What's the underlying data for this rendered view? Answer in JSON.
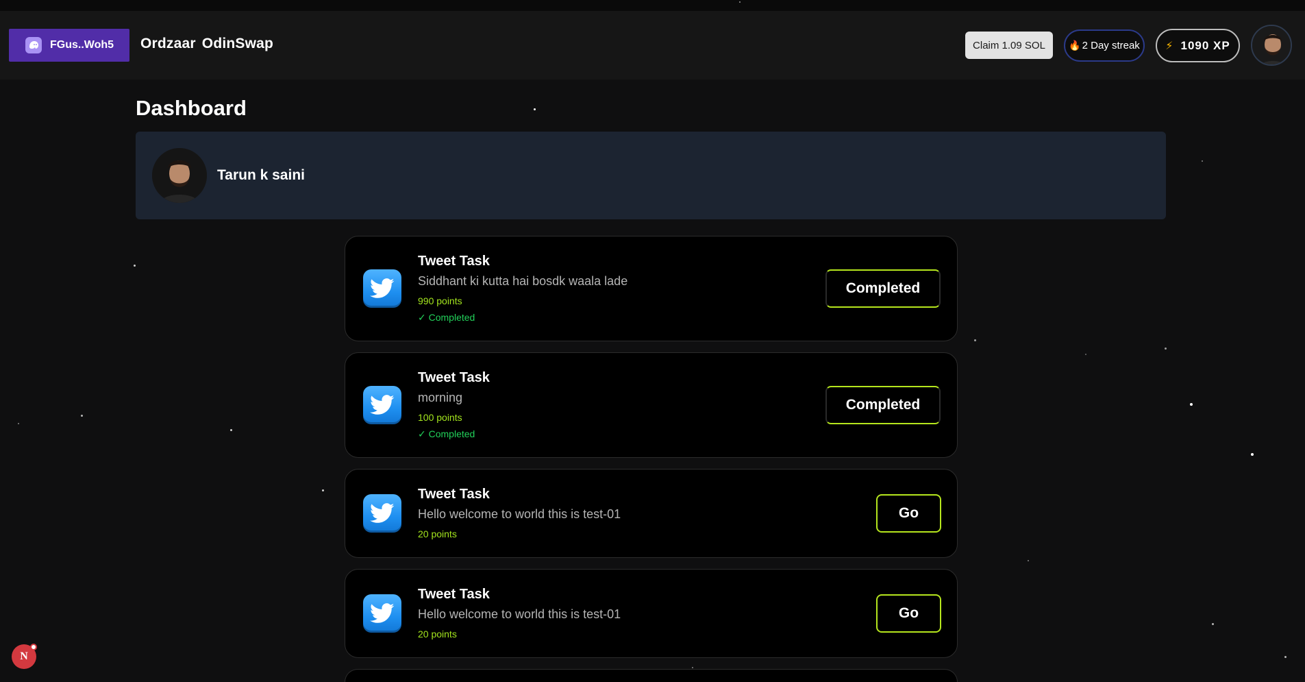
{
  "header": {
    "wallet_label": "FGus..Woh5",
    "brand": "Ordzaar  OdinSwap",
    "claim_label": "Claim 1.09 SOL",
    "streak_label": "2 Day streak",
    "xp_label": "1090 XP"
  },
  "page": {
    "title": "Dashboard"
  },
  "profile": {
    "name": "Tarun k saini"
  },
  "tasks": [
    {
      "title": "Tweet Task",
      "description": "Siddhant ki kutta hai bosdk waala lade",
      "points": "990 points",
      "status": "✓ Completed",
      "action": "Completed"
    },
    {
      "title": "Tweet Task",
      "description": "morning",
      "points": "100 points",
      "status": "✓ Completed",
      "action": "Completed"
    },
    {
      "title": "Tweet Task",
      "description": "Hello welcome to world this is test-01",
      "points": "20 points",
      "action": "Go"
    },
    {
      "title": "Tweet Task",
      "description": "Hello welcome to world this is test-01",
      "points": "20 points",
      "action": "Go"
    }
  ],
  "dev_badge": {
    "letter": "N"
  },
  "colors": {
    "background": "#0f0f10",
    "header": "#161616",
    "wallet_button": "#512da8",
    "profile_card": "#1c2431",
    "accent_green": "#b5e61d",
    "points_green": "#a4e61e",
    "status_green": "#22d15a",
    "twitter_blue": "#1e8ff0"
  },
  "icons": {
    "wallet": "wallet-icon",
    "streak": "flame-icon",
    "xp": "lightning-icon",
    "task": "twitter-icon"
  }
}
